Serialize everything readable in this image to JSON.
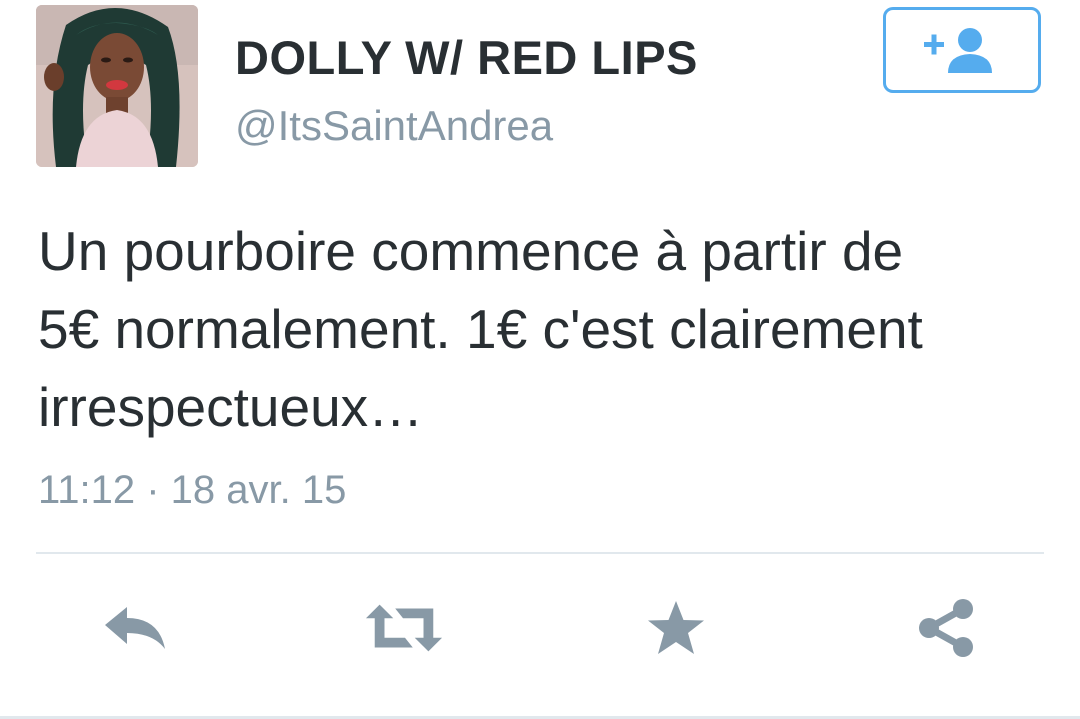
{
  "author": {
    "display_name": "DOLLY W/ RED LIPS",
    "handle": "@ItsSaintAndrea"
  },
  "follow_button": {
    "icon": "add-user-icon"
  },
  "tweet": {
    "text": "Un pourboire commence à partir de\n5€ normalement. 1€ c'est clairement\nirrespectueux…",
    "timestamp": "11:12 · 18 avr. 15"
  },
  "actions": [
    {
      "icon": "reply-icon"
    },
    {
      "icon": "retweet-icon"
    },
    {
      "icon": "favorite-star-icon"
    },
    {
      "icon": "share-icon"
    }
  ],
  "colors": {
    "accent": "#55acee",
    "icon_gray": "#8899a6",
    "text": "#292f33",
    "divider": "#e1e8ed"
  }
}
